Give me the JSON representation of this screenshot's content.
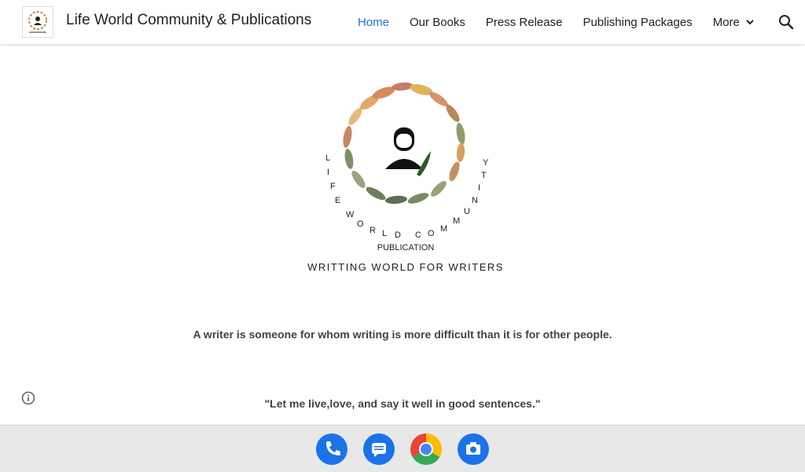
{
  "header": {
    "site_title": "Life World Community & Publications",
    "nav": [
      {
        "label": "Home",
        "active": true
      },
      {
        "label": "Our Books"
      },
      {
        "label": "Press Release"
      },
      {
        "label": "Publishing Packages"
      },
      {
        "label": "More"
      }
    ],
    "search_icon": "search-icon"
  },
  "logo": {
    "arc_text": "LIFE WORLD COMMUNITY",
    "subtitle": "PUBLICATION",
    "tagline": "WRITTING WORLD FOR WRITERS"
  },
  "quotes": [
    "A writer is someone for whom writing is more difficult than it is for other people.",
    "\"Let me live,love, and say it well in good sentences.\""
  ],
  "dock": {
    "apps": [
      "phone-icon",
      "messages-icon",
      "chrome-icon",
      "camera-icon"
    ]
  },
  "colors": {
    "accent": "#1a73e8",
    "text": "#212121",
    "dock_bg": "#e8e8e8"
  }
}
